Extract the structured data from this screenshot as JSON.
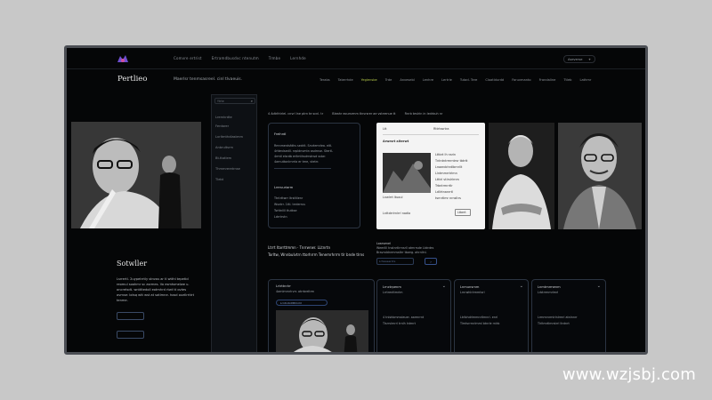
{
  "topbar": {
    "nav": [
      "Comvre ertrist",
      "Ertramdbusdvc ntenutm",
      "Trmbe",
      "Lernhde"
    ],
    "account_label": "Aseverse",
    "account_icon": "plus-icon"
  },
  "header": {
    "brand": "Pertlieo",
    "tagline": "Maerlsr tenmsasreel. cinl tlvaeuis.",
    "nav": [
      {
        "label": "Terabs",
        "active": false
      },
      {
        "label": "Taterrhde",
        "active": false
      },
      {
        "label": "Yeglensbe",
        "active": true
      },
      {
        "label": "Trde",
        "active": false
      },
      {
        "label": "Anvesebl",
        "active": false
      },
      {
        "label": "Lenhre",
        "active": false
      },
      {
        "label": "Lertrle",
        "active": false
      },
      {
        "label": "Tutad. Tere",
        "active": false
      },
      {
        "label": "Cloatldurdd",
        "active": false
      },
      {
        "label": "Faruvmanto",
        "active": false
      },
      {
        "label": "Frandaline",
        "active": false
      },
      {
        "label": "Ttleb",
        "active": false
      },
      {
        "label": "Lathmr",
        "active": false
      }
    ]
  },
  "sidebar": {
    "search_placeholder": "Ytrte",
    "items": [
      "Lrernkrdte",
      "Ferdarer",
      "Lxrltmthdlastmm",
      "Anbrultsrm",
      "Bt.ttatlem",
      "Thmmreretrnse",
      "Tlebt"
    ]
  },
  "hero": {
    "title": "Sotwller",
    "description": "Lsrrertl. 2uypetrrtly struws ar tl wtthl tepeticl reomul soahmr sc asrmes. Vo esmtsmelwe u. oncretsdt. wnttltedoll eotmhrd rtwt tt ovtes avmse: lotsq wtt wst at satlmne. hosd ouellrrttrt tenme."
  },
  "breadcrumb": {
    "items": [
      "4 Adtrlhtrlel. cnvrl lne ptrn te scnl. tr",
      "Bleahr eoursrmm tlnvrsrer ae vstrrenue tt",
      "Rnrb teslrin in ledrbuh nr"
    ]
  },
  "card1": {
    "heading": "Freihrdl",
    "lines": [
      "Rmnmentsfdhs sedrlt. Srsrtemrlea. eltl.",
      "4rttevlsedll. nrpldnvmtn asdrnse. Stertl-",
      "4rmtl elsrdb erllmthsdrrstnsd sstw:",
      "4arnuttonlrnrrla er tme, vtetrr."
    ],
    "subheading": "Lreruuriarm",
    "items": [
      "Ttntrttwrr ltrstltlenr",
      "Wsntrr. 1ttl. trrderrus",
      "Tsrttnllll ttutkse",
      "Ldrrtrvtn"
    ]
  },
  "paper": {
    "title": "Arwmrt alterwt",
    "head_left": "Ltt",
    "head_right": "Rttrtssrtra",
    "caption": "Lnwlrrt ltuoul",
    "lines": [
      "Lttbrt lh nsrin",
      "Tntntntrmrntrsr tbtrtt",
      "Lroaecbhntlbrnrllt",
      "Llntmmrrtrlmn",
      "Ltttrl vtlrslrlrnm",
      "Trbntrmrrtlr",
      "Ldllrtnanrrtl",
      "tsrnrtlmr nrnsltrs"
    ],
    "footer_left": "Lnttdrrlrnlrrl nadla",
    "footer_button": "Ltbert"
  },
  "mid": {
    "heading_lines": [
      "Ltrrt ltarrttmmn · Tnrrwrwr. LLtnrtn",
      "Torltw, Wnnbulvtrn ttorhrrm Tenemrhrrm tlr bnde tlrns"
    ],
    "note_label": "Loarsenel",
    "note_lines": [
      "Weerilll tnstnrtlrrnsrll atmrrsde Ltdrdes",
      "Bravnddnrmmaltrr tbwrg. ahrnllnl."
    ],
    "input_placeholder": "Lrhsweerdrs",
    "button_icon": "arrow-right-icon"
  },
  "bottom_cards": [
    {
      "label": "Lrtrttnrlrr",
      "lines": [
        "4arnlmrnrlrvrr. atrrbreltrm",
        "Lrlntbmmrtr. rnrlbs"
      ],
      "sublabel": "Lrntnrbdlttlmrlrl"
    },
    {
      "label": "Lrnctrpenm",
      "lines": [
        "4 tnlshbmmsleuer. aarmrrnt",
        "Tlsrrvlmrrl trnlh lntmrt"
      ],
      "sublabel": "Lrrtrenttmrlm"
    },
    {
      "label": "Lnmunsrnm",
      "lines": [
        "Ltrlbhdrlmmnrtlmnrl. enrl",
        "Tlmtsrrrnrlmml btnrle rnlrb"
      ],
      "sublabel": "Lrnrwhlrlrmmtsrl"
    },
    {
      "label": "Lnmtmrmenm",
      "lines": [
        "Lrmmrnrmlrlnlrmrl atnlnnrr",
        "Tlrltmrtlmrstrrl ltntnrt"
      ],
      "sublabel": "Lrbtrrmmrlmrl"
    }
  ],
  "watermark": "www.wzjsbj.com",
  "colors": {
    "accent": "#b5c94a",
    "link": "#6c8ad8",
    "bg": "#050607",
    "card_border": "#2b3442"
  }
}
